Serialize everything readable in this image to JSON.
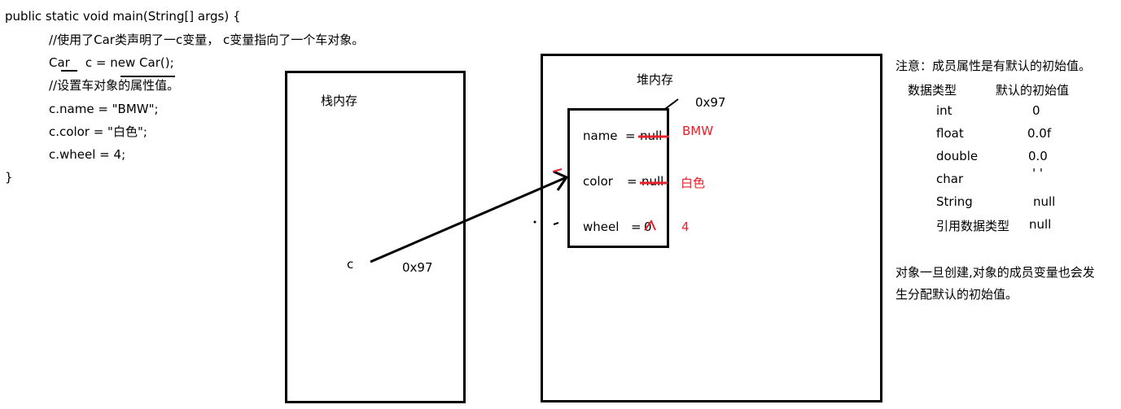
{
  "code": {
    "lines": [
      "public static void main(String[] args) {",
      "//使用了Car类声明了一c变量， c变量指向了一个车对象。",
      "Car    c = new Car();",
      "//设置车对象的属性值。",
      "c.name = \"BMW\";",
      "c.color = \"白色\";",
      "c.wheel = 4;",
      "}"
    ]
  },
  "stack": {
    "title": "栈内存",
    "var_name": "c",
    "var_value": "0x97"
  },
  "heap": {
    "title": "堆内存",
    "address": "0x97",
    "fields": [
      {
        "name": "name",
        "eq": "=",
        "default": "null",
        "assigned": "BMW"
      },
      {
        "name": "color",
        "eq": "=",
        "default": "null",
        "assigned": "白色"
      },
      {
        "name": "wheel",
        "eq": "=",
        "default": "0",
        "assigned": "4"
      }
    ]
  },
  "notes": {
    "heading": "注意：成员属性是有默认的初始值。",
    "col_type": "数据类型",
    "col_default": "默认的初始值",
    "rows": [
      {
        "type": "int",
        "value": "0"
      },
      {
        "type": "float",
        "value": "0.0f"
      },
      {
        "type": "double",
        "value": "0.0"
      },
      {
        "type": "char",
        "value": "' '"
      },
      {
        "type": "String",
        "value": "null"
      },
      {
        "type": "引用数据类型",
        "value": "null"
      }
    ],
    "footer_1": "对象一旦创建,对象的成员变量也会发",
    "footer_2": "生分配默认的初始值。"
  },
  "colors": {
    "annotation": "#e8202a",
    "ink": "#000000"
  }
}
